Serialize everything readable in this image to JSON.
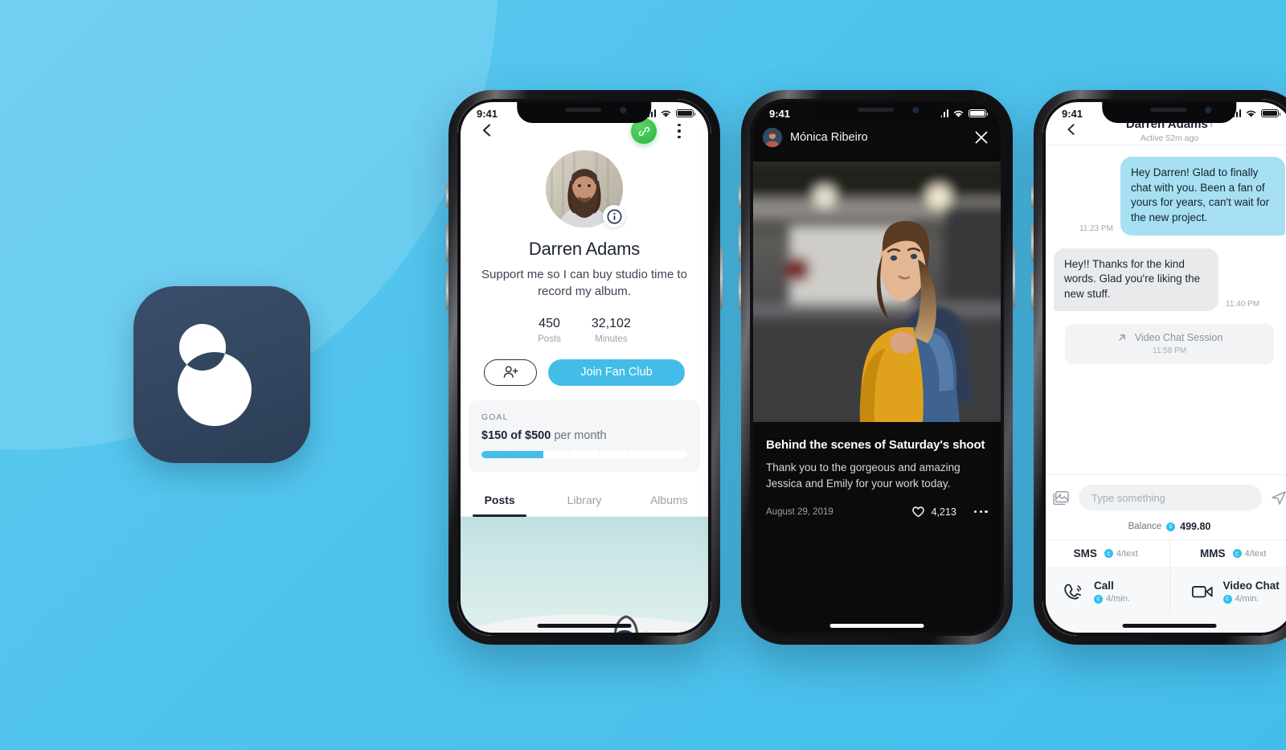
{
  "background": {
    "color": "#4fc3ed",
    "accent_blue": "#43bde8",
    "brand_navy": "#33465f"
  },
  "app_icon": {
    "name": "app-icon-logo",
    "bg": "#33465f",
    "mark": "two-overlapping-circles"
  },
  "phone1": {
    "status": {
      "time": "9:41",
      "signal": "signal-bars-icon",
      "wifi": "wifi-icon",
      "battery": "battery-icon"
    },
    "nav": {
      "back": "back-chevron-icon",
      "link_button": "link-icon",
      "more": "kebab-menu-icon"
    },
    "profile": {
      "avatar": "profile-avatar",
      "info_badge": "info-icon",
      "name": "Darren Adams",
      "bio": "Support me so I can buy studio time to record my album."
    },
    "stats": [
      {
        "value": "450",
        "label": "Posts"
      },
      {
        "value": "32,102",
        "label": "Minutes"
      }
    ],
    "actions": {
      "add_friend": "add-person-icon",
      "join_label": "Join Fan Club"
    },
    "goal": {
      "label": "GOAL",
      "current": "$150",
      "of_word": "of",
      "target": "$500",
      "period": "per month",
      "percent": 30
    },
    "tabs": [
      {
        "label": "Posts",
        "active": true
      },
      {
        "label": "Library",
        "active": false
      },
      {
        "label": "Albums",
        "active": false
      }
    ]
  },
  "phone2": {
    "status": {
      "time": "9:41"
    },
    "header": {
      "avatar": "user-avatar",
      "name": "Mónica Ribeiro",
      "close": "close-icon"
    },
    "post": {
      "image": "woman-in-yellow-shirt-photo",
      "title": "Behind the scenes of Saturday's shoot",
      "text": "Thank you to the gorgeous and amazing Jessica and Emily for your work today.",
      "date": "August 29, 2019",
      "likes": "4,213",
      "like_icon": "heart-icon",
      "more": "more-dots-icon"
    }
  },
  "phone3": {
    "status": {
      "time": "9:41"
    },
    "nav": {
      "back": "back-chevron-icon",
      "title": "Darren Adams",
      "chevron": "›",
      "subtitle": "Active 52m ago"
    },
    "messages": [
      {
        "dir": "out",
        "text": "Hey Darren! Glad to finally chat with you. Been a fan of yours for years, can't wait for the new project.",
        "time": "11:23 PM"
      },
      {
        "dir": "in",
        "text": "Hey!! Thanks for the kind words. Glad you're liking the new stuff.",
        "time": "11:40 PM"
      }
    ],
    "session": {
      "icon": "arrow-up-right-icon",
      "label": "Video Chat Session",
      "time": "11:58 PM"
    },
    "compose": {
      "attach_icon": "image-icon",
      "placeholder": "Type something",
      "value": "",
      "send_icon": "send-icon"
    },
    "balance": {
      "label": "Balance",
      "coin": "coin-icon",
      "amount": "499.80"
    },
    "rates": [
      {
        "label": "SMS",
        "price": "4/text"
      },
      {
        "label": "MMS",
        "price": "4/text"
      }
    ],
    "actions": [
      {
        "icon": "phone-icon",
        "label": "Call",
        "price": "4/min."
      },
      {
        "icon": "video-camera-icon",
        "label": "Video Chat",
        "price": "4/min."
      }
    ]
  }
}
